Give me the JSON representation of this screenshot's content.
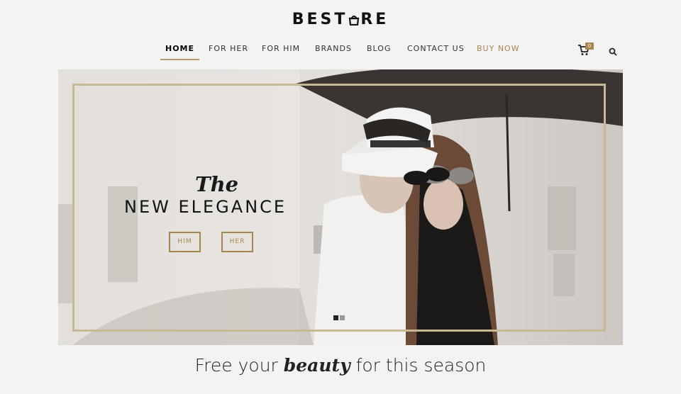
{
  "brand": {
    "logo_pre": "BEST",
    "logo_post": "RE",
    "logo_mark": "bag-icon"
  },
  "nav": {
    "items": [
      {
        "label": "HOME",
        "active": true
      },
      {
        "label": "FOR HER"
      },
      {
        "label": "FOR HIM"
      },
      {
        "label": "BRANDS"
      },
      {
        "label": "BLOG"
      },
      {
        "label": "CONTACT US"
      },
      {
        "label": "BUY NOW",
        "accent": true
      }
    ],
    "cart_count": "0",
    "accent_color": "#a8864f"
  },
  "hero": {
    "title_small": "The",
    "title_main": "NEW ELEGANCE",
    "buttons": [
      "HIM",
      "HER"
    ],
    "slides": 2,
    "active_slide": 1
  },
  "tagline": {
    "before": "Free your ",
    "emphasis": "beauty",
    "after": " for this season"
  }
}
